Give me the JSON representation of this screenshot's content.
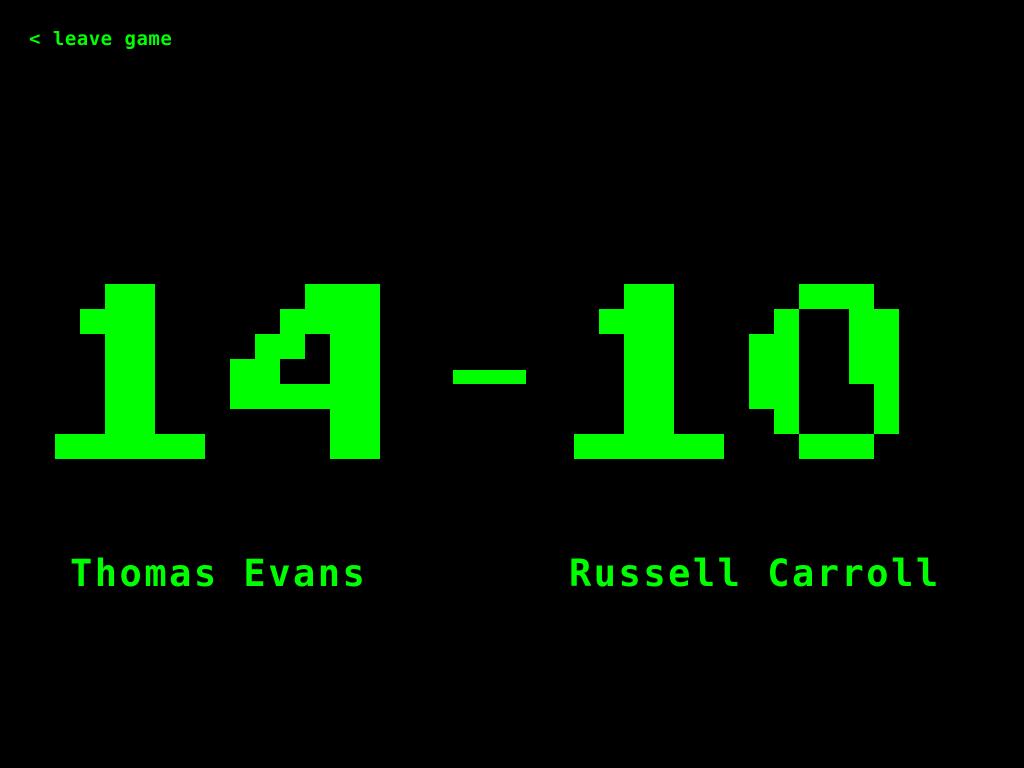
{
  "nav": {
    "leave_label": "< leave game"
  },
  "score": {
    "left": "14",
    "separator": "-",
    "right": "10"
  },
  "players": {
    "left_name": "Thomas Evans",
    "right_name": "Russell Carroll"
  },
  "colors": {
    "background": "#000000",
    "foreground": "#00FF00"
  }
}
